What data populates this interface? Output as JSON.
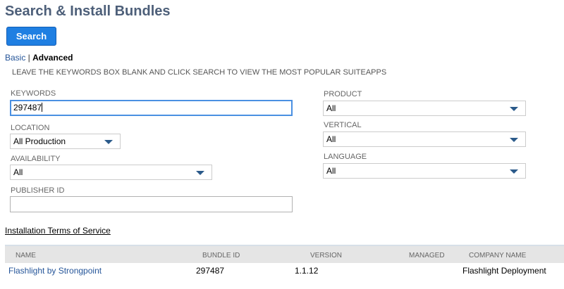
{
  "page": {
    "title": "Search & Install Bundles"
  },
  "toolbar": {
    "search_label": "Search"
  },
  "mode": {
    "basic": "Basic",
    "separator": " | ",
    "advanced": "Advanced"
  },
  "hint": "LEAVE THE KEYWORDS BOX BLANK AND CLICK SEARCH TO VIEW THE MOST POPULAR SUITEAPPS",
  "form": {
    "keywords": {
      "label": "KEYWORDS",
      "value": "297487"
    },
    "location": {
      "label": "LOCATION",
      "value": "All Production"
    },
    "availability": {
      "label": "AVAILABILITY",
      "value": "All"
    },
    "publisher_id": {
      "label": "PUBLISHER ID",
      "value": ""
    },
    "product": {
      "label": "PRODUCT",
      "value": "All"
    },
    "vertical": {
      "label": "VERTICAL",
      "value": "All"
    },
    "language": {
      "label": "LANGUAGE",
      "value": "All"
    }
  },
  "terms_link": "Installation Terms of Service",
  "results": {
    "columns": [
      "NAME",
      "BUNDLE ID",
      "VERSION",
      "MANAGED",
      "COMPANY NAME"
    ],
    "rows": [
      {
        "name": "Flashlight by Strongpoint",
        "bundle_id": "297487",
        "version": "1.1.12",
        "managed": "",
        "company": "Flashlight Deployment"
      }
    ]
  },
  "colors": {
    "accent": "#1f7fe2",
    "title": "#4d5f79",
    "link": "#255599",
    "focus": "#4a90e2"
  }
}
